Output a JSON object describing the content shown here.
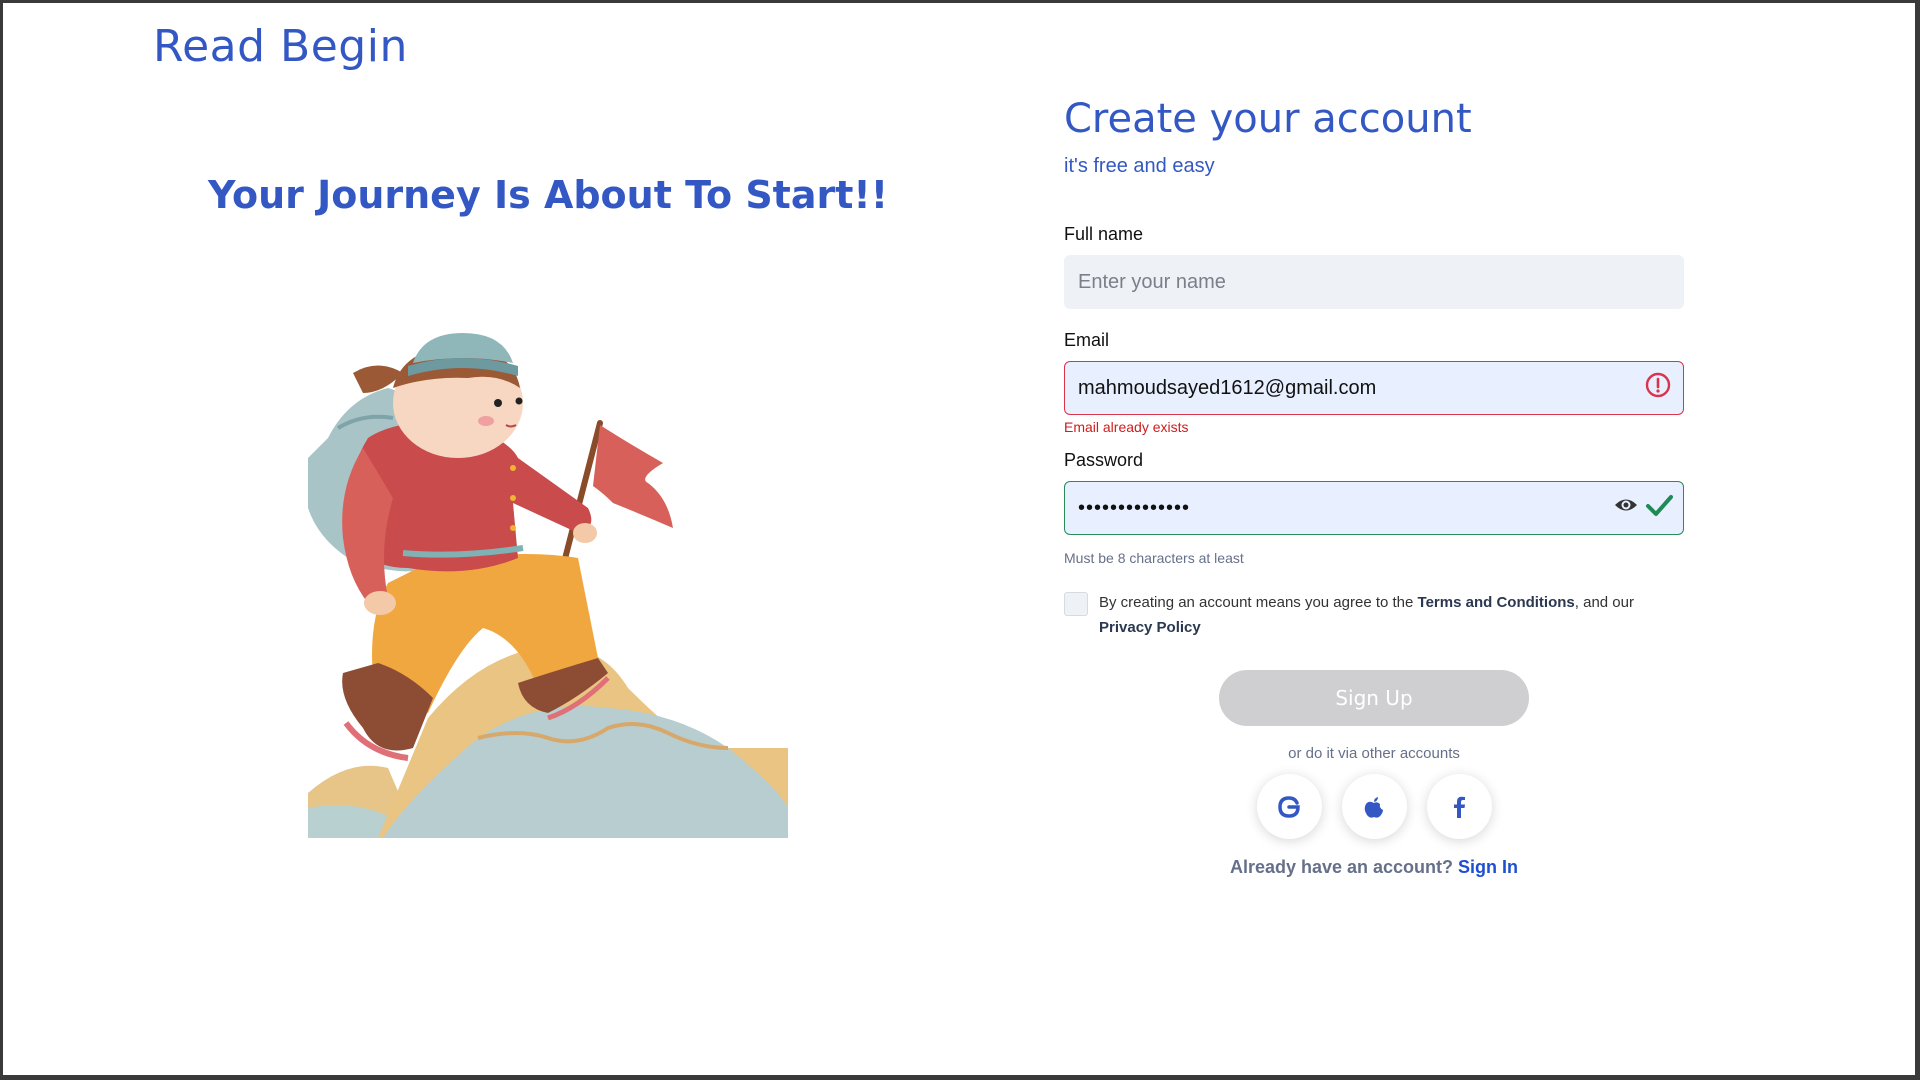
{
  "brand": {
    "logo_text": "Read Begin"
  },
  "hero": {
    "title": "Your Journey Is About To Start!!"
  },
  "form": {
    "title": "Create your account",
    "subtitle": "it's free and easy",
    "full_name": {
      "label": "Full name",
      "placeholder": "Enter your name",
      "value": ""
    },
    "email": {
      "label": "Email",
      "value": "mahmoudsayed1612@gmail.com",
      "error": "Email already exists",
      "status": "error"
    },
    "password": {
      "label": "Password",
      "value": "••••••••••••••",
      "hint": "Must be 8 characters at least",
      "status": "valid"
    },
    "terms": {
      "prefix": "By creating an account means you agree to the ",
      "terms_link": "Terms and Conditions",
      "middle": ", and our ",
      "privacy_link": "Privacy Policy",
      "checked": false
    },
    "signup_button": "Sign Up",
    "alt_text": "or do it via other accounts",
    "socials": [
      "google-icon",
      "apple-icon",
      "facebook-icon"
    ],
    "signin_prompt": "Already have an account?",
    "signin_link": "Sign In"
  },
  "colors": {
    "brand": "#3358c4",
    "error": "#d9344c",
    "valid": "#2a8a5a",
    "button_disabled": "#cfcfd1"
  }
}
